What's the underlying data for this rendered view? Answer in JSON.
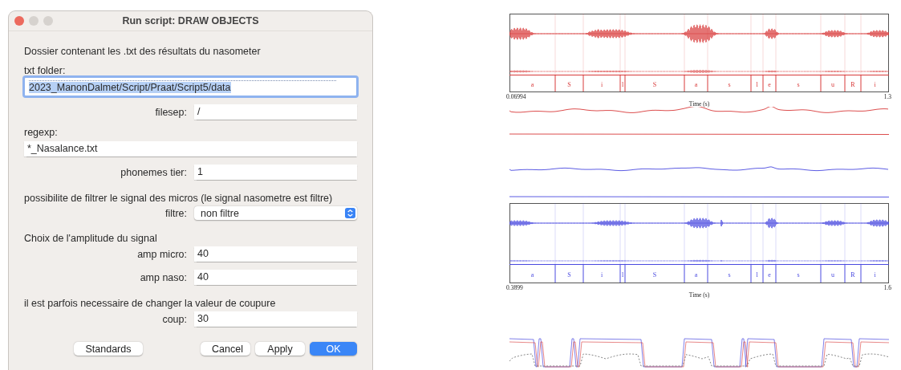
{
  "window": {
    "title": "Run script: DRAW OBJECTS"
  },
  "dialog": {
    "items": [
      {
        "kind": "heading",
        "text": "Dossier contenant les .txt des résultats du nasometer"
      },
      {
        "kind": "label",
        "text": "txt folder:"
      },
      {
        "kind": "path-field",
        "value": "2023_ManonDalmet/Script/Praat/Script5/data",
        "highlighted": true
      },
      {
        "kind": "field",
        "label": "filesep:",
        "value": "/"
      },
      {
        "kind": "label",
        "text": "regexp:"
      },
      {
        "kind": "wide-field",
        "value": "*_Nasalance.txt"
      },
      {
        "kind": "field",
        "label": "phonemes tier:",
        "value": "1"
      },
      {
        "kind": "heading",
        "text": "possibilite de filtrer le signal des micros (le signal nasometre est filtre)"
      },
      {
        "kind": "dropdown",
        "label": "filtre:",
        "value": "non filtre"
      },
      {
        "kind": "heading",
        "text": "Choix de l'amplitude du signal"
      },
      {
        "kind": "field",
        "label": "amp micro:",
        "value": "40"
      },
      {
        "kind": "field",
        "label": "amp naso:",
        "value": "40"
      },
      {
        "kind": "heading",
        "text": "il est parfois necessaire de changer la valeur de coupure"
      },
      {
        "kind": "field",
        "label": "coup:",
        "value": "30"
      }
    ],
    "buttons": [
      {
        "label": "Standards",
        "kind": "left"
      },
      {
        "label": "Cancel",
        "kind": "normal"
      },
      {
        "label": "Apply",
        "kind": "normal"
      },
      {
        "label": "OK",
        "kind": "default"
      }
    ]
  },
  "picture": {
    "plots": [
      {
        "color": "#d83a3a",
        "tier_labels": [
          "a",
          "S",
          "i",
          "l",
          "S",
          "a",
          "s",
          "l",
          "e",
          "s",
          "u",
          "R",
          "i"
        ],
        "x_start": "0.06994",
        "x_end": "1.3",
        "x_label": "Time (s)"
      },
      {
        "color": "#4a4ae0",
        "tier_labels": [
          "a",
          "S",
          "i",
          "l",
          "S",
          "a",
          "s",
          "l",
          "e",
          "s",
          "u",
          "R",
          "i"
        ],
        "x_start": "0.3899",
        "x_end": "1.6",
        "x_label": "Time (s)"
      }
    ]
  }
}
